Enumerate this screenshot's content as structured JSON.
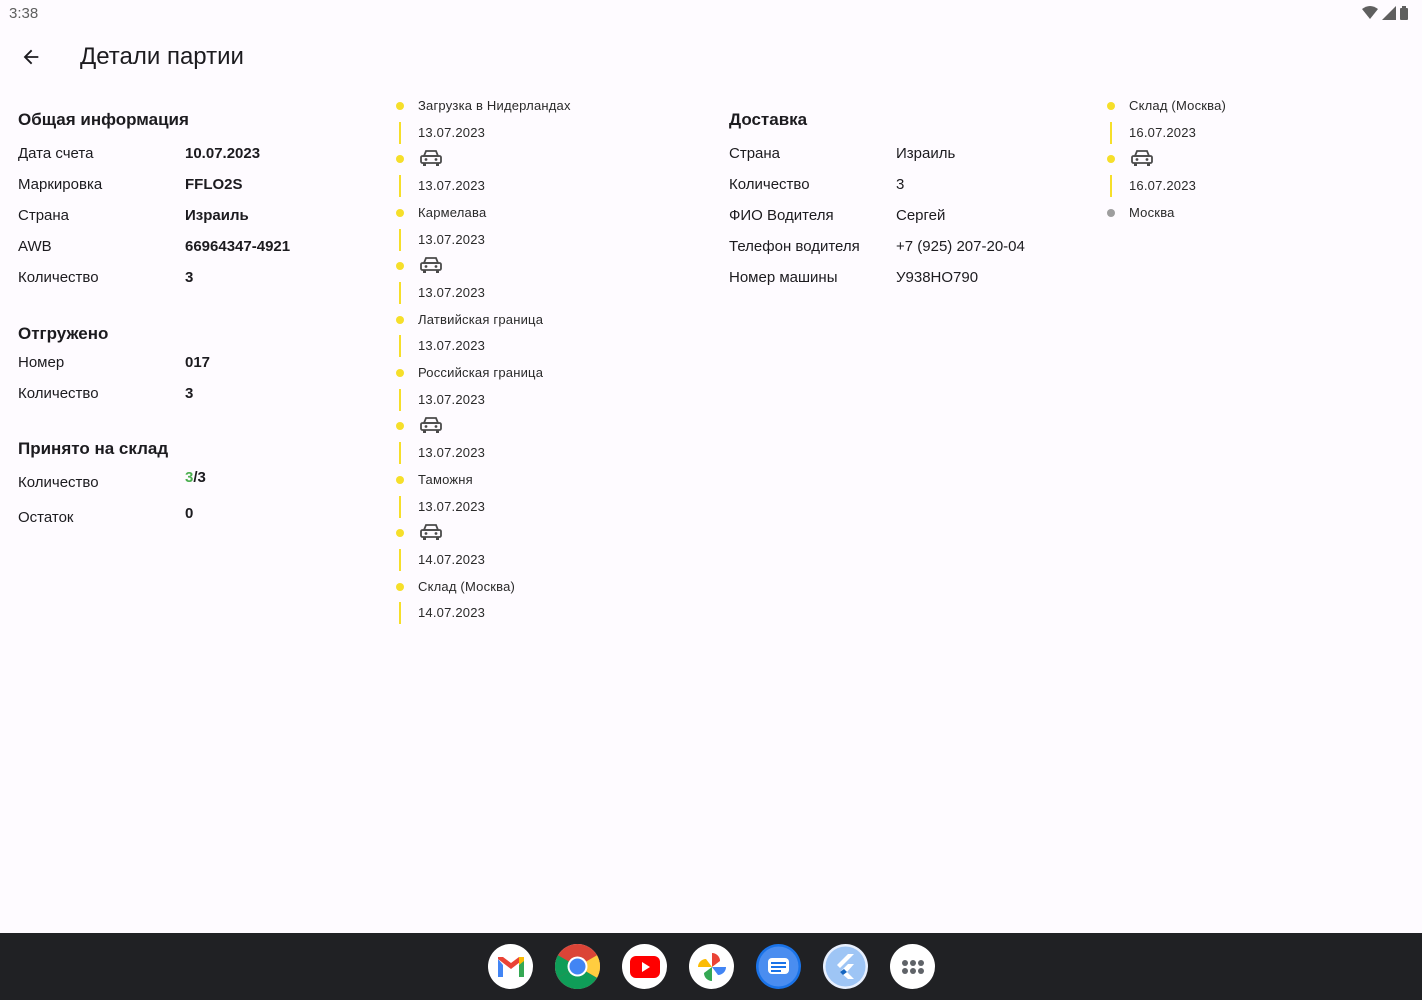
{
  "status": {
    "time": "3:38"
  },
  "header": {
    "title": "Детали партии"
  },
  "general": {
    "title": "Общая информация",
    "rows": [
      {
        "label": "Дата счета",
        "value": "10.07.2023"
      },
      {
        "label": "Маркировка",
        "value": "FFLO2S"
      },
      {
        "label": "Страна",
        "value": "Израиль"
      },
      {
        "label": "AWB",
        "value": "66964347-4921"
      },
      {
        "label": "Количество",
        "value": "3"
      }
    ]
  },
  "shipped": {
    "title": "Отгружено",
    "rows": [
      {
        "label": "Номер",
        "value": "017"
      },
      {
        "label": "Количество",
        "value": "3"
      }
    ]
  },
  "warehouse": {
    "title": "Принято на склад",
    "quantity_label": "Количество",
    "quantity_received": "3",
    "quantity_total": "/3",
    "remainder_label": "Остаток",
    "remainder_value": "0"
  },
  "timeline1": [
    {
      "kind": "label",
      "text": "Загрузка в Нидерландах"
    },
    {
      "kind": "date",
      "text": "13.07.2023"
    },
    {
      "kind": "car"
    },
    {
      "kind": "date",
      "text": "13.07.2023"
    },
    {
      "kind": "label",
      "text": "Кармелава"
    },
    {
      "kind": "date",
      "text": "13.07.2023"
    },
    {
      "kind": "car"
    },
    {
      "kind": "date",
      "text": "13.07.2023"
    },
    {
      "kind": "label",
      "text": "Латвийская граница"
    },
    {
      "kind": "date",
      "text": "13.07.2023"
    },
    {
      "kind": "label",
      "text": "Российская граница"
    },
    {
      "kind": "date",
      "text": "13.07.2023"
    },
    {
      "kind": "car"
    },
    {
      "kind": "date",
      "text": "13.07.2023"
    },
    {
      "kind": "label",
      "text": "Таможня"
    },
    {
      "kind": "date",
      "text": "13.07.2023"
    },
    {
      "kind": "car"
    },
    {
      "kind": "date",
      "text": "14.07.2023"
    },
    {
      "kind": "label",
      "text": "Склад (Москва)"
    },
    {
      "kind": "date",
      "text": "14.07.2023"
    }
  ],
  "delivery": {
    "title": "Доставка",
    "rows": [
      {
        "label": "Страна",
        "value": "Израиль"
      },
      {
        "label": "Количество",
        "value": "3"
      },
      {
        "label": "ФИО Водителя",
        "value": "Сергей"
      },
      {
        "label": "Телефон водителя",
        "value": "+7 (925) 207-20-04"
      },
      {
        "label": "Номер машины",
        "value": "У938НО790"
      }
    ]
  },
  "timeline2": [
    {
      "kind": "label",
      "text": "Склад (Москва)"
    },
    {
      "kind": "date",
      "text": "16.07.2023"
    },
    {
      "kind": "car"
    },
    {
      "kind": "date",
      "text": "16.07.2023"
    },
    {
      "kind": "label",
      "text": "Москва",
      "dot": "grey"
    }
  ],
  "dock": [
    {
      "name": "gmail-icon"
    },
    {
      "name": "chrome-icon"
    },
    {
      "name": "youtube-icon"
    },
    {
      "name": "photos-icon"
    },
    {
      "name": "messages-icon"
    },
    {
      "name": "flutter-icon"
    },
    {
      "name": "app-launcher-icon"
    }
  ],
  "colors": {
    "accent": "#f6df2a",
    "green": "#4caf50",
    "taskbar": "#202124"
  }
}
